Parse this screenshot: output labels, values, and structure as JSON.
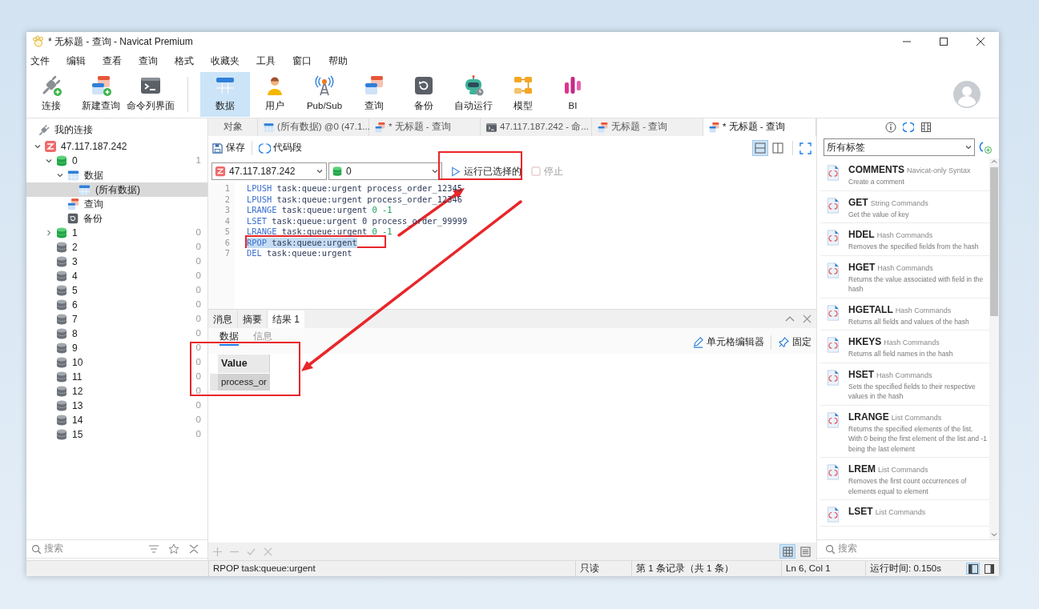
{
  "window": {
    "title": "* 无标题 - 查询 - Navicat Premium"
  },
  "menu": [
    "文件",
    "编辑",
    "查看",
    "查询",
    "格式",
    "收藏夹",
    "工具",
    "窗口",
    "帮助"
  ],
  "toolbar": {
    "groups": [
      [
        {
          "label": "连接",
          "kind": "connect",
          "selected": false
        },
        {
          "label": "新建查询",
          "kind": "new-query",
          "selected": false
        },
        {
          "label": "命令列界面",
          "kind": "console",
          "selected": false
        }
      ],
      [
        {
          "label": "数据",
          "kind": "data",
          "selected": true
        },
        {
          "label": "用户",
          "kind": "user",
          "selected": false
        },
        {
          "label": "Pub/Sub",
          "kind": "pubsub",
          "selected": false
        },
        {
          "label": "查询",
          "kind": "query",
          "selected": false
        },
        {
          "label": "备份",
          "kind": "backup",
          "selected": false
        },
        {
          "label": "自动运行",
          "kind": "automation",
          "selected": false
        },
        {
          "label": "模型",
          "kind": "model",
          "selected": false
        },
        {
          "label": "BI",
          "kind": "bi",
          "selected": false
        }
      ]
    ]
  },
  "sidebar": {
    "header": "我的连接",
    "tree": [
      {
        "label": "47.117.187.242",
        "kind": "server",
        "selected": false,
        "expanded": true,
        "children": [
          {
            "label": "0",
            "kind": "db",
            "loaded": true,
            "count": "1",
            "selected": false,
            "expanded": true,
            "children": [
              {
                "label": "数据",
                "kind": "data",
                "selected": false,
                "expanded": true,
                "children": [
                  {
                    "label": "(所有数据)",
                    "kind": "table",
                    "selected": true
                  }
                ]
              },
              {
                "label": "查询",
                "kind": "query",
                "selected": false
              },
              {
                "label": "备份",
                "kind": "backup",
                "selected": false
              }
            ]
          },
          {
            "label": "1",
            "kind": "db",
            "loaded": true,
            "count": "0",
            "selected": false,
            "expanded": false
          },
          {
            "label": "2",
            "kind": "db",
            "loaded": false,
            "count": "0",
            "selected": false
          },
          {
            "label": "3",
            "kind": "db",
            "loaded": false,
            "count": "0",
            "selected": false
          },
          {
            "label": "4",
            "kind": "db",
            "loaded": false,
            "count": "0",
            "selected": false
          },
          {
            "label": "5",
            "kind": "db",
            "loaded": false,
            "count": "0",
            "selected": false
          },
          {
            "label": "6",
            "kind": "db",
            "loaded": false,
            "count": "0",
            "selected": false
          },
          {
            "label": "7",
            "kind": "db",
            "loaded": false,
            "count": "0",
            "selected": false
          },
          {
            "label": "8",
            "kind": "db",
            "loaded": false,
            "count": "0",
            "selected": false
          },
          {
            "label": "9",
            "kind": "db",
            "loaded": false,
            "count": "0",
            "selected": false
          },
          {
            "label": "10",
            "kind": "db",
            "loaded": false,
            "count": "0",
            "selected": false
          },
          {
            "label": "11",
            "kind": "db",
            "loaded": false,
            "count": "0",
            "selected": false
          },
          {
            "label": "12",
            "kind": "db",
            "loaded": false,
            "count": "0",
            "selected": false
          },
          {
            "label": "13",
            "kind": "db",
            "loaded": false,
            "count": "0",
            "selected": false
          },
          {
            "label": "14",
            "kind": "db",
            "loaded": false,
            "count": "0",
            "selected": false
          },
          {
            "label": "15",
            "kind": "db",
            "loaded": false,
            "count": "0",
            "selected": false
          }
        ]
      }
    ],
    "search": {
      "placeholder": "搜索"
    }
  },
  "tabs": [
    {
      "label": "对象",
      "kind": "object",
      "selected": false
    },
    {
      "label": "(所有数据) @0 (47.1...",
      "kind": "data",
      "selected": false
    },
    {
      "label": "* 无标题 - 查询",
      "kind": "query",
      "selected": false
    },
    {
      "label": "47.117.187.242 - 命...",
      "kind": "console",
      "selected": false
    },
    {
      "label": "无标题 - 查询",
      "kind": "query",
      "selected": false
    },
    {
      "label": "* 无标题 - 查询",
      "kind": "query",
      "selected": true
    }
  ],
  "editor": {
    "tools": [
      {
        "label": "保存",
        "kind": "save"
      },
      {
        "label": "代码段",
        "kind": "snippet"
      }
    ],
    "layouts": [
      {
        "kind": "stacked",
        "selected": true
      },
      {
        "kind": "side-by-side",
        "selected": false
      }
    ],
    "connection": "47.117.187.242",
    "database": "0",
    "run": "运行已选择的",
    "stop": {
      "label": "停止",
      "disabled": true
    },
    "lines": [
      {
        "number": "1",
        "command": "LPUSH",
        "segments": [
          {
            "text": "task:queue:urgent process_order_12345",
            "kind": "plain"
          }
        ],
        "selected": false
      },
      {
        "number": "2",
        "command": "LPUSH",
        "segments": [
          {
            "text": "task:queue:urgent process_order_12346",
            "kind": "plain"
          }
        ],
        "selected": false
      },
      {
        "number": "3",
        "command": "LRANGE",
        "segments": [
          {
            "text": "task:queue:urgent",
            "kind": "plain"
          },
          {
            "text": "0 -1",
            "kind": "number"
          }
        ],
        "selected": false
      },
      {
        "number": "4",
        "command": "LSET",
        "segments": [
          {
            "text": "task:queue:urgent 0 process_order_99999",
            "kind": "plain"
          }
        ],
        "selected": false
      },
      {
        "number": "5",
        "command": "LRANGE",
        "segments": [
          {
            "text": "task:queue:urgent",
            "kind": "plain"
          },
          {
            "text": "0 -1",
            "kind": "number"
          }
        ],
        "selected": false
      },
      {
        "number": "6",
        "command": "RPOP",
        "segments": [
          {
            "text": "task:queue:urgent",
            "kind": "plain"
          }
        ],
        "selected": true
      },
      {
        "number": "7",
        "command": "DEL",
        "segments": [
          {
            "text": "task:queue:urgent",
            "kind": "plain"
          }
        ],
        "selected": false
      }
    ]
  },
  "results": {
    "tabs": [
      {
        "label": "消息",
        "selected": false
      },
      {
        "label": "摘要",
        "selected": false
      },
      {
        "label": "结果 1",
        "selected": true
      }
    ],
    "subtabs": [
      {
        "label": "数据",
        "selected": true
      },
      {
        "label": "信息",
        "selected": false
      }
    ],
    "tools": [
      {
        "label": "单元格编辑器",
        "kind": "cell-editor"
      },
      {
        "label": "固定",
        "kind": "pin"
      }
    ],
    "grid": {
      "columns": [
        "Value"
      ],
      "rows": [
        [
          "process_or"
        ]
      ]
    },
    "views": [
      {
        "kind": "grid",
        "selected": true
      },
      {
        "kind": "form",
        "selected": false
      }
    ]
  },
  "snippets_panel": {
    "tabs": [
      {
        "kind": "info",
        "selected": false
      },
      {
        "kind": "snippets",
        "selected": true
      },
      {
        "kind": "columns",
        "selected": false
      }
    ],
    "filter": "所有标签",
    "items": [
      {
        "name": "COMMENTS",
        "category": "Navicat-only Syntax",
        "description": "Create a comment"
      },
      {
        "name": "GET",
        "category": "String Commands",
        "description": "Get the value of key"
      },
      {
        "name": "HDEL",
        "category": "Hash Commands",
        "description": "Removes the specified fields from the hash"
      },
      {
        "name": "HGET",
        "category": "Hash Commands",
        "description": "Returns the value associated with field in the hash"
      },
      {
        "name": "HGETALL",
        "category": "Hash Commands",
        "description": "Returns all fields and values of the hash"
      },
      {
        "name": "HKEYS",
        "category": "Hash Commands",
        "description": "Returns all field names in the hash"
      },
      {
        "name": "HSET",
        "category": "Hash Commands",
        "description": "Sets the specified fields to their respective values in the hash"
      },
      {
        "name": "LRANGE",
        "category": "List Commands",
        "description": "Returns the specified elements of the list. With 0 being the first element of the list and -1 being the last element"
      },
      {
        "name": "LREM",
        "category": "List Commands",
        "description": "Removes the first count occurrences of elements equal to element"
      },
      {
        "name": "LSET",
        "category": "List Commands"
      }
    ],
    "search": {
      "placeholder": "搜索"
    }
  },
  "status_bar": {
    "items": [
      "RPOP task:queue:urgent",
      "只读",
      "第 1 条记录（共 1 条）",
      "Ln 6, Col 1",
      "运行时间: 0.150s"
    ],
    "layouts": [
      {
        "kind": "split",
        "selected": true
      },
      {
        "kind": "single",
        "selected": false
      }
    ]
  }
}
